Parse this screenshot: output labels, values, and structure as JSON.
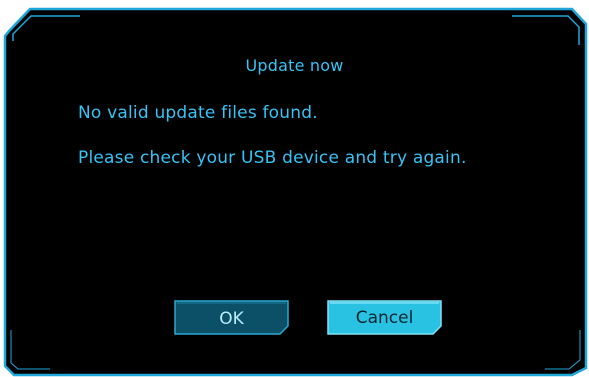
{
  "dialog": {
    "title": "Update now",
    "message_line1": "No valid update files found.",
    "message_line2": "Please check your USB device and  try again."
  },
  "buttons": {
    "ok_label": "OK",
    "cancel_label": "Cancel"
  },
  "colors": {
    "background": "#000000",
    "accent": "#36c3f5",
    "frame": "#1ea7d8",
    "ok_fill": "#0c5068",
    "cancel_fill": "#29c2e3"
  }
}
